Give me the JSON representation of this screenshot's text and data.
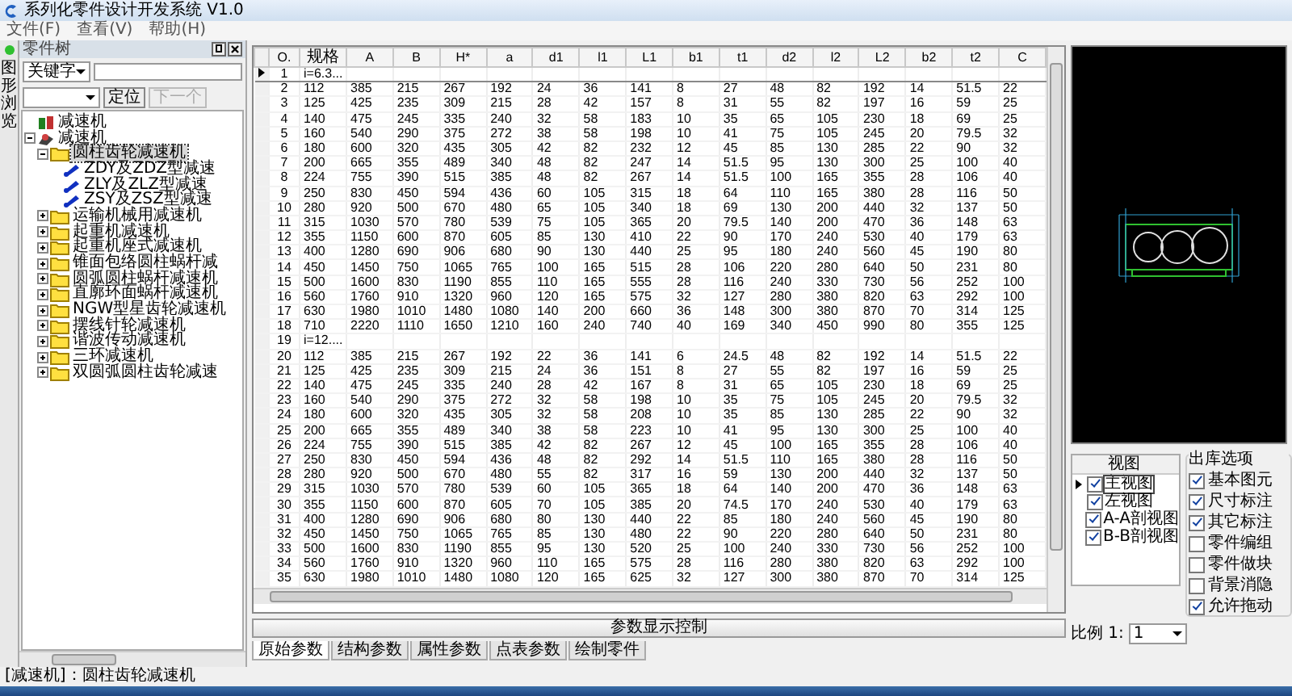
{
  "window": {
    "title": "系列化零件设计开发系统 V1.0"
  },
  "menu": [
    "文件(F)",
    "查看(V)",
    "帮助(H)"
  ],
  "side_tab": {
    "label": "图形浏览"
  },
  "tree_panel": {
    "title": "零件树",
    "search_kind": "关键字",
    "locate_buttons": [
      {
        "label": "定位",
        "disabled": false
      },
      {
        "label": "下一个",
        "disabled": true
      }
    ]
  },
  "tree": {
    "items": [
      {
        "label": "减速机",
        "kind": "root",
        "selected": false
      },
      {
        "label": "减速机",
        "kind": "machine",
        "expanded": true,
        "selected": false,
        "children": [
          {
            "label": "圆柱齿轮减速机",
            "kind": "folder",
            "expanded": true,
            "selected": true,
            "children": [
              {
                "label": "ZDY及ZDZ型减速",
                "kind": "part",
                "selected": false
              },
              {
                "label": "ZLY及ZLZ型减速",
                "kind": "part",
                "selected": false
              },
              {
                "label": "ZSY及ZSZ型减速",
                "kind": "part",
                "selected": false
              }
            ]
          },
          {
            "label": "运输机械用减速机",
            "kind": "folder",
            "expanded": false,
            "selected": false
          },
          {
            "label": "起重机减速机",
            "kind": "folder",
            "expanded": false,
            "selected": false
          },
          {
            "label": "起重机座式减速机",
            "kind": "folder",
            "expanded": false,
            "selected": false
          },
          {
            "label": "锥面包络圆柱蜗杆减",
            "kind": "folder",
            "expanded": false,
            "selected": false
          },
          {
            "label": "圆弧圆柱蜗杆减速机",
            "kind": "folder",
            "expanded": false,
            "selected": false
          },
          {
            "label": "直廓环面蜗杆减速机",
            "kind": "folder",
            "expanded": false,
            "selected": false
          },
          {
            "label": "NGW型星齿轮减速机",
            "kind": "folder",
            "expanded": false,
            "selected": false
          },
          {
            "label": "摆线针轮减速机",
            "kind": "folder",
            "expanded": false,
            "selected": false
          },
          {
            "label": "谐波传动减速机",
            "kind": "folder",
            "expanded": false,
            "selected": false
          },
          {
            "label": "三环减速机",
            "kind": "folder",
            "expanded": false,
            "selected": false
          },
          {
            "label": "双圆弧圆柱齿轮减速",
            "kind": "folder",
            "expanded": false,
            "selected": false
          }
        ]
      }
    ]
  },
  "status_bar": "[减速机]：圆柱齿轮减速机",
  "table": {
    "columns": [
      "O.",
      "规格",
      "A",
      "B",
      "H*",
      "a",
      "d1",
      "l1",
      "L1",
      "b1",
      "t1",
      "d2",
      "l2",
      "L2",
      "b2",
      "t2",
      "C"
    ],
    "rows": [
      {
        "no": "1",
        "kind": "group",
        "label": "i=6.3...",
        "selected": true
      },
      {
        "no": "2",
        "kind": "data",
        "selected": false,
        "cells": [
          "112",
          "385",
          "215",
          "267",
          "192",
          "24",
          "36",
          "141",
          "8",
          "27",
          "48",
          "82",
          "192",
          "14",
          "51.5",
          "22"
        ]
      },
      {
        "no": "3",
        "kind": "data",
        "selected": false,
        "cells": [
          "125",
          "425",
          "235",
          "309",
          "215",
          "28",
          "42",
          "157",
          "8",
          "31",
          "55",
          "82",
          "197",
          "16",
          "59",
          "25"
        ]
      },
      {
        "no": "4",
        "kind": "data",
        "selected": false,
        "cells": [
          "140",
          "475",
          "245",
          "335",
          "240",
          "32",
          "58",
          "183",
          "10",
          "35",
          "65",
          "105",
          "230",
          "18",
          "69",
          "25"
        ]
      },
      {
        "no": "5",
        "kind": "data",
        "selected": false,
        "cells": [
          "160",
          "540",
          "290",
          "375",
          "272",
          "38",
          "58",
          "198",
          "10",
          "41",
          "75",
          "105",
          "245",
          "20",
          "79.5",
          "32"
        ]
      },
      {
        "no": "6",
        "kind": "data",
        "selected": false,
        "cells": [
          "180",
          "600",
          "320",
          "435",
          "305",
          "42",
          "82",
          "232",
          "12",
          "45",
          "85",
          "130",
          "285",
          "22",
          "90",
          "32"
        ]
      },
      {
        "no": "7",
        "kind": "data",
        "selected": false,
        "cells": [
          "200",
          "665",
          "355",
          "489",
          "340",
          "48",
          "82",
          "247",
          "14",
          "51.5",
          "95",
          "130",
          "300",
          "25",
          "100",
          "40"
        ]
      },
      {
        "no": "8",
        "kind": "data",
        "selected": false,
        "cells": [
          "224",
          "755",
          "390",
          "515",
          "385",
          "48",
          "82",
          "267",
          "14",
          "51.5",
          "100",
          "165",
          "355",
          "28",
          "106",
          "40"
        ]
      },
      {
        "no": "9",
        "kind": "data",
        "selected": false,
        "cells": [
          "250",
          "830",
          "450",
          "594",
          "436",
          "60",
          "105",
          "315",
          "18",
          "64",
          "110",
          "165",
          "380",
          "28",
          "116",
          "50"
        ]
      },
      {
        "no": "10",
        "kind": "data",
        "selected": false,
        "cells": [
          "280",
          "920",
          "500",
          "670",
          "480",
          "65",
          "105",
          "340",
          "18",
          "69",
          "130",
          "200",
          "440",
          "32",
          "137",
          "50"
        ]
      },
      {
        "no": "11",
        "kind": "data",
        "selected": false,
        "cells": [
          "315",
          "1030",
          "570",
          "780",
          "539",
          "75",
          "105",
          "365",
          "20",
          "79.5",
          "140",
          "200",
          "470",
          "36",
          "148",
          "63"
        ]
      },
      {
        "no": "12",
        "kind": "data",
        "selected": false,
        "cells": [
          "355",
          "1150",
          "600",
          "870",
          "605",
          "85",
          "130",
          "410",
          "22",
          "90",
          "170",
          "240",
          "530",
          "40",
          "179",
          "63"
        ]
      },
      {
        "no": "13",
        "kind": "data",
        "selected": false,
        "cells": [
          "400",
          "1280",
          "690",
          "906",
          "680",
          "90",
          "130",
          "440",
          "25",
          "95",
          "180",
          "240",
          "560",
          "45",
          "190",
          "80"
        ]
      },
      {
        "no": "14",
        "kind": "data",
        "selected": false,
        "cells": [
          "450",
          "1450",
          "750",
          "1065",
          "765",
          "100",
          "165",
          "515",
          "28",
          "106",
          "220",
          "280",
          "640",
          "50",
          "231",
          "80"
        ]
      },
      {
        "no": "15",
        "kind": "data",
        "selected": false,
        "cells": [
          "500",
          "1600",
          "830",
          "1190",
          "855",
          "110",
          "165",
          "555",
          "28",
          "116",
          "240",
          "330",
          "730",
          "56",
          "252",
          "100"
        ]
      },
      {
        "no": "16",
        "kind": "data",
        "selected": false,
        "cells": [
          "560",
          "1760",
          "910",
          "1320",
          "960",
          "120",
          "165",
          "575",
          "32",
          "127",
          "280",
          "380",
          "820",
          "63",
          "292",
          "100"
        ]
      },
      {
        "no": "17",
        "kind": "data",
        "selected": false,
        "cells": [
          "630",
          "1980",
          "1010",
          "1480",
          "1080",
          "140",
          "200",
          "660",
          "36",
          "148",
          "300",
          "380",
          "870",
          "70",
          "314",
          "125"
        ]
      },
      {
        "no": "18",
        "kind": "data",
        "selected": false,
        "cells": [
          "710",
          "2220",
          "1110",
          "1650",
          "1210",
          "160",
          "240",
          "740",
          "40",
          "169",
          "340",
          "450",
          "990",
          "80",
          "355",
          "125"
        ]
      },
      {
        "no": "19",
        "kind": "group",
        "label": "i=12....",
        "selected": false
      },
      {
        "no": "20",
        "kind": "data",
        "selected": false,
        "cells": [
          "112",
          "385",
          "215",
          "267",
          "192",
          "22",
          "36",
          "141",
          "6",
          "24.5",
          "48",
          "82",
          "192",
          "14",
          "51.5",
          "22"
        ]
      },
      {
        "no": "21",
        "kind": "data",
        "selected": false,
        "cells": [
          "125",
          "425",
          "235",
          "309",
          "215",
          "24",
          "36",
          "151",
          "8",
          "27",
          "55",
          "82",
          "197",
          "16",
          "59",
          "25"
        ]
      },
      {
        "no": "22",
        "kind": "data",
        "selected": false,
        "cells": [
          "140",
          "475",
          "245",
          "335",
          "240",
          "28",
          "42",
          "167",
          "8",
          "31",
          "65",
          "105",
          "230",
          "18",
          "69",
          "25"
        ]
      },
      {
        "no": "23",
        "kind": "data",
        "selected": false,
        "cells": [
          "160",
          "540",
          "290",
          "375",
          "272",
          "32",
          "58",
          "198",
          "10",
          "35",
          "75",
          "105",
          "245",
          "20",
          "79.5",
          "32"
        ]
      },
      {
        "no": "24",
        "kind": "data",
        "selected": false,
        "cells": [
          "180",
          "600",
          "320",
          "435",
          "305",
          "32",
          "58",
          "208",
          "10",
          "35",
          "85",
          "130",
          "285",
          "22",
          "90",
          "32"
        ]
      },
      {
        "no": "25",
        "kind": "data",
        "selected": false,
        "cells": [
          "200",
          "665",
          "355",
          "489",
          "340",
          "38",
          "58",
          "223",
          "10",
          "41",
          "95",
          "130",
          "300",
          "25",
          "100",
          "40"
        ]
      },
      {
        "no": "26",
        "kind": "data",
        "selected": false,
        "cells": [
          "224",
          "755",
          "390",
          "515",
          "385",
          "42",
          "82",
          "267",
          "12",
          "45",
          "100",
          "165",
          "355",
          "28",
          "106",
          "40"
        ]
      },
      {
        "no": "27",
        "kind": "data",
        "selected": false,
        "cells": [
          "250",
          "830",
          "450",
          "594",
          "436",
          "48",
          "82",
          "292",
          "14",
          "51.5",
          "110",
          "165",
          "380",
          "28",
          "116",
          "50"
        ]
      },
      {
        "no": "28",
        "kind": "data",
        "selected": false,
        "cells": [
          "280",
          "920",
          "500",
          "670",
          "480",
          "55",
          "82",
          "317",
          "16",
          "59",
          "130",
          "200",
          "440",
          "32",
          "137",
          "50"
        ]
      },
      {
        "no": "29",
        "kind": "data",
        "selected": false,
        "cells": [
          "315",
          "1030",
          "570",
          "780",
          "539",
          "60",
          "105",
          "365",
          "18",
          "64",
          "140",
          "200",
          "470",
          "36",
          "148",
          "63"
        ]
      },
      {
        "no": "30",
        "kind": "data",
        "selected": false,
        "cells": [
          "355",
          "1150",
          "600",
          "870",
          "605",
          "70",
          "105",
          "385",
          "20",
          "74.5",
          "170",
          "240",
          "530",
          "40",
          "179",
          "63"
        ]
      },
      {
        "no": "31",
        "kind": "data",
        "selected": false,
        "cells": [
          "400",
          "1280",
          "690",
          "906",
          "680",
          "80",
          "130",
          "440",
          "22",
          "85",
          "180",
          "240",
          "560",
          "45",
          "190",
          "80"
        ]
      },
      {
        "no": "32",
        "kind": "data",
        "selected": false,
        "cells": [
          "450",
          "1450",
          "750",
          "1065",
          "765",
          "85",
          "130",
          "480",
          "22",
          "90",
          "220",
          "280",
          "640",
          "50",
          "231",
          "80"
        ]
      },
      {
        "no": "33",
        "kind": "data",
        "selected": false,
        "cells": [
          "500",
          "1600",
          "830",
          "1190",
          "855",
          "95",
          "130",
          "520",
          "25",
          "100",
          "240",
          "330",
          "730",
          "56",
          "252",
          "100"
        ]
      },
      {
        "no": "34",
        "kind": "data",
        "selected": false,
        "cells": [
          "560",
          "1760",
          "910",
          "1320",
          "960",
          "110",
          "165",
          "575",
          "28",
          "116",
          "280",
          "380",
          "820",
          "63",
          "292",
          "100"
        ]
      },
      {
        "no": "35",
        "kind": "data",
        "selected": false,
        "cells": [
          "630",
          "1980",
          "1010",
          "1480",
          "1080",
          "120",
          "165",
          "625",
          "32",
          "127",
          "300",
          "380",
          "870",
          "70",
          "314",
          "125"
        ]
      }
    ]
  },
  "control_bar": "参数显示控制",
  "bottom_tabs": [
    {
      "label": "原始参数",
      "selected": true
    },
    {
      "label": "结构参数",
      "selected": false
    },
    {
      "label": "属性参数",
      "selected": false
    },
    {
      "label": "点表参数",
      "selected": false
    },
    {
      "label": "绘制零件",
      "selected": false
    }
  ],
  "views": {
    "header": "视图",
    "items": [
      {
        "label": "主视图",
        "checked": true,
        "selected": true
      },
      {
        "label": "左视图",
        "checked": true,
        "selected": false
      },
      {
        "label": "A-A剖视图",
        "checked": true,
        "selected": false
      },
      {
        "label": "B-B剖视图",
        "checked": true,
        "selected": false
      }
    ]
  },
  "scale": {
    "label": "比例 1:",
    "value": "1"
  },
  "options": {
    "title": "出库选项",
    "items": [
      {
        "label": "基本图元",
        "checked": true
      },
      {
        "label": "尺寸标注",
        "checked": true
      },
      {
        "label": "其它标注",
        "checked": true
      },
      {
        "label": "零件编组",
        "checked": false
      },
      {
        "label": "零件做块",
        "checked": false
      },
      {
        "label": "背景消隐",
        "checked": false
      },
      {
        "label": "允许拖动",
        "checked": true
      }
    ]
  }
}
